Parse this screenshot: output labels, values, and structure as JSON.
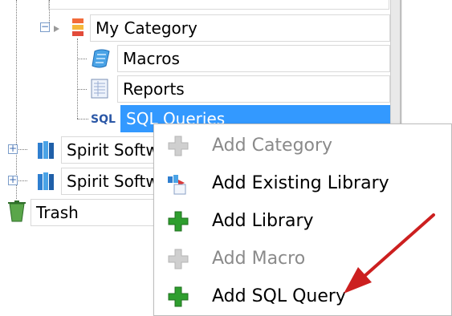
{
  "tree": {
    "items": [
      {
        "label": "My Category",
        "icon": "category-icon"
      },
      {
        "label": "Macros",
        "icon": "macros-icon"
      },
      {
        "label": "Reports",
        "icon": "reports-icon"
      },
      {
        "label": "SQL Queries",
        "icon": "sql-icon",
        "selected": true
      },
      {
        "label": "Spirit Softw",
        "icon": "library-icon"
      },
      {
        "label": "Spirit Softw",
        "icon": "library-icon"
      },
      {
        "label": "Trash",
        "icon": "trash-icon"
      }
    ]
  },
  "context_menu": {
    "items": [
      {
        "label": "Add Category",
        "icon": "plus-icon",
        "enabled": false
      },
      {
        "label": "Add Existing Library",
        "icon": "existing-library-icon",
        "enabled": true
      },
      {
        "label": "Add Library",
        "icon": "plus-icon",
        "enabled": true
      },
      {
        "label": "Add Macro",
        "icon": "plus-icon",
        "enabled": false
      },
      {
        "label": "Add SQL Query",
        "icon": "plus-icon",
        "enabled": true
      }
    ]
  },
  "colors": {
    "selection": "#3399ff",
    "disabled_text": "#8a8a8a",
    "plus_enabled": "#2e9e2e",
    "arrow": "#cc1f1f"
  }
}
